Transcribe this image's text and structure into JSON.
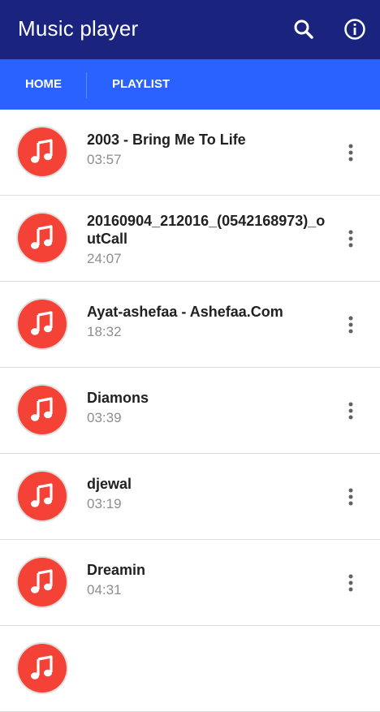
{
  "app": {
    "title": "Music player"
  },
  "tabs": [
    {
      "label": "HOME"
    },
    {
      "label": "PLAYLIST"
    }
  ],
  "colors": {
    "appbar": "#1a237e",
    "tabbar": "#2962ff",
    "avatar": "#f44336"
  },
  "icons": [
    "search-icon",
    "info-icon",
    "music-note-icon",
    "more-vert-icon"
  ],
  "songs": [
    {
      "title": "2003 - Bring Me To Life",
      "duration": "03:57"
    },
    {
      "title": "20160904_212016_(0542168973)_outCall",
      "duration": "24:07"
    },
    {
      "title": "Ayat-ashefaa - Ashefaa.Com",
      "duration": "18:32"
    },
    {
      "title": "Diamons",
      "duration": "03:39"
    },
    {
      "title": "djewal",
      "duration": "03:19"
    },
    {
      "title": "Dreamin",
      "duration": "04:31"
    }
  ]
}
